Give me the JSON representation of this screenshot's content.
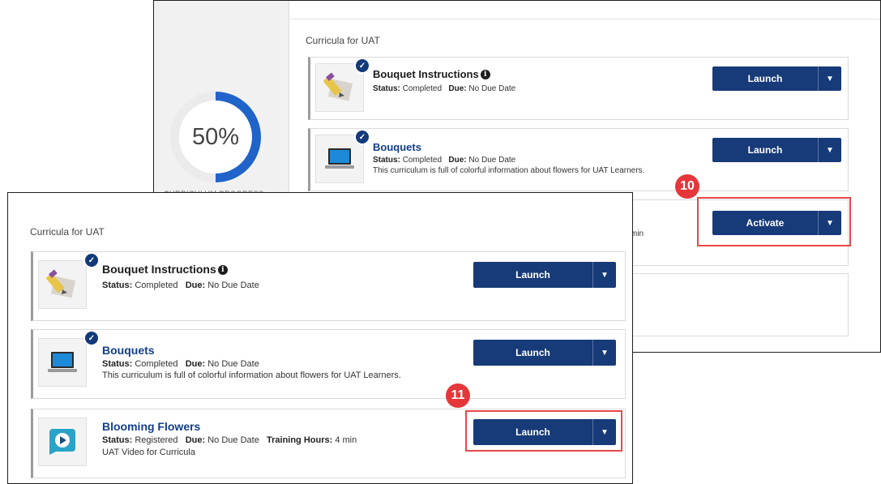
{
  "back_window": {
    "progress": {
      "percent_text": "50%",
      "percent_value": 50,
      "caption": "CURRICULUM PROGRESS"
    },
    "section_title": "Curricula for UAT",
    "items": [
      {
        "title": "Bouquet Instructions",
        "status_label": "Status:",
        "status": "Completed",
        "due_label": "Due:",
        "due": "No Due Date",
        "button": "Launch"
      },
      {
        "title": "Bouquets",
        "status_label": "Status:",
        "status": "Completed",
        "due_label": "Due:",
        "due": "No Due Date",
        "description": "This curriculum is full of colorful information about flowers for UAT Learners.",
        "button": "Launch"
      }
    ],
    "partial_text": "min",
    "activate_button": "Activate",
    "callout_number": "10"
  },
  "front_window": {
    "section_title": "Curricula for UAT",
    "items": [
      {
        "title": "Bouquet Instructions",
        "status_label": "Status:",
        "status": "Completed",
        "due_label": "Due:",
        "due": "No Due Date",
        "button": "Launch"
      },
      {
        "title": "Bouquets",
        "status_label": "Status:",
        "status": "Completed",
        "due_label": "Due:",
        "due": "No Due Date",
        "description": "This curriculum is full of colorful information about flowers for UAT Learners.",
        "button": "Launch"
      },
      {
        "title": "Blooming Flowers",
        "status_label": "Status:",
        "status": "Registered",
        "due_label": "Due:",
        "due": "No Due Date",
        "hours_label": "Training Hours:",
        "hours": "4 min",
        "description": "UAT Video for Curricula",
        "button": "Launch"
      }
    ],
    "callout_number": "11"
  },
  "colors": {
    "primary_button": "#173a78",
    "link_title": "#123f8c",
    "callout": "#e8474a",
    "progress": "#2063c9"
  }
}
